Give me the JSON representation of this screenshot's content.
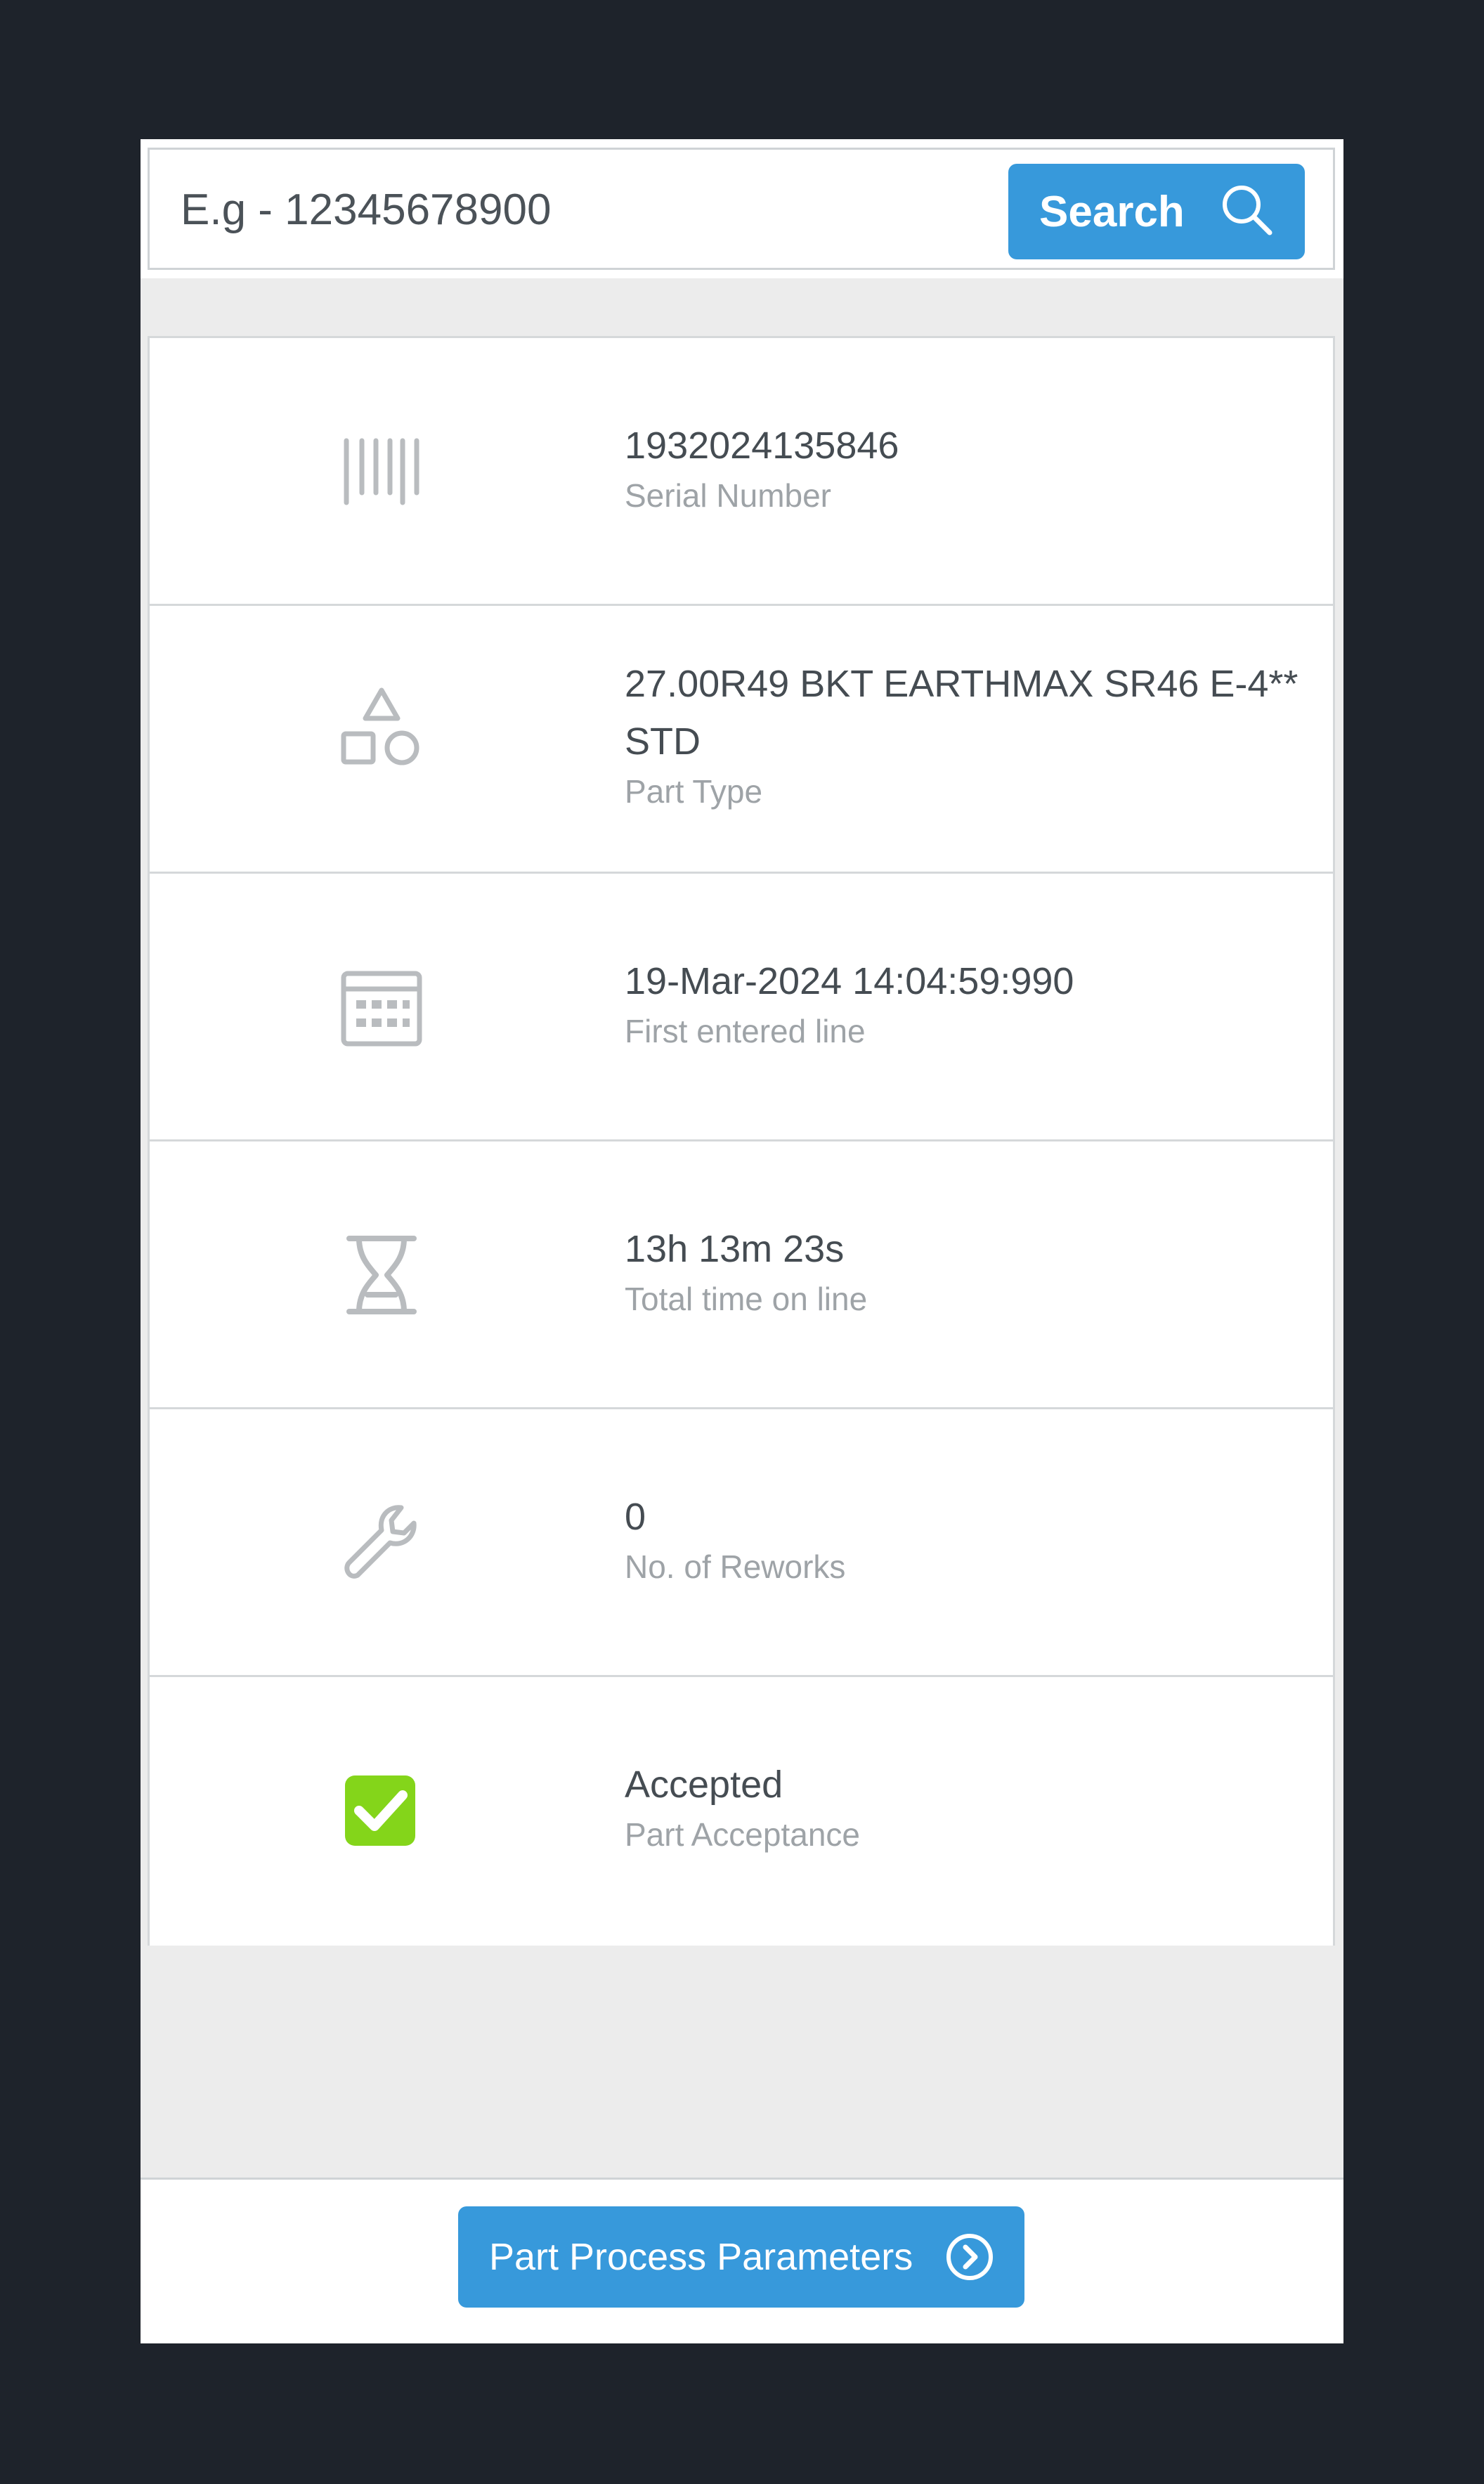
{
  "search": {
    "placeholder": "E.g - 12345678900",
    "button_label": "Search",
    "icon": "search-icon"
  },
  "details": [
    {
      "icon": "barcode-icon",
      "value": "1932024135846",
      "label": "Serial Number"
    },
    {
      "icon": "shapes-icon",
      "value": "27.00R49 BKT EARTHMAX SR46 E-4** STD",
      "label": "Part Type"
    },
    {
      "icon": "calendar-icon",
      "value": "19-Mar-2024 14:04:59:990",
      "label": "First entered line"
    },
    {
      "icon": "hourglass-icon",
      "value": "13h 13m 23s",
      "label": "Total time on line"
    },
    {
      "icon": "wrench-icon",
      "value": "0",
      "label": "No. of Reworks"
    },
    {
      "icon": "check-square-icon",
      "value": "Accepted",
      "label": "Part Acceptance"
    }
  ],
  "footer": {
    "button_label": "Part Process Parameters",
    "icon": "chevron-right-circle-icon"
  },
  "colors": {
    "accent": "#3799db",
    "accepted": "#84d51a",
    "icon_gray": "#b9bcbf",
    "page_background": "#1e232b"
  }
}
